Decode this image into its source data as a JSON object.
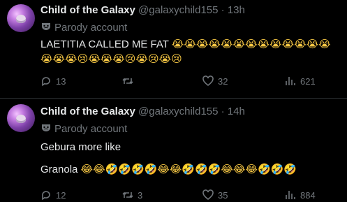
{
  "tweets": [
    {
      "name": "Child of the Galaxy",
      "handle": "@galaxychild155",
      "separator": "·",
      "time": "13h",
      "parody_label": "Parody account",
      "text_line1": "LAETITIA CALLED ME FAT ",
      "emoji_line1": "😭😭😭😭😭😭😭😭😭😭😭😭😭",
      "emoji_line2": "😭😭😭😢😭😭😭😢😭😢😭😢",
      "reply_count": "13",
      "retweet_count": "",
      "like_count": "32",
      "view_count": "621"
    },
    {
      "name": "Child of the Galaxy",
      "handle": "@galaxychild155",
      "separator": "·",
      "time": "14h",
      "parody_label": "Parody account",
      "text_line1": "Gebura more like",
      "text_line2": "Granola ",
      "emoji_line2": "😂😂🤣🤣🤣🤣😂😂🤣🤣🤣😂😂😂🤣🤣🤣",
      "reply_count": "12",
      "retweet_count": "3",
      "like_count": "35",
      "view_count": "884"
    }
  ],
  "icons": {
    "reply": "reply-icon",
    "retweet": "retweet-icon",
    "like": "heart-icon",
    "views": "views-chart-icon",
    "parody": "mask-icon"
  },
  "colors": {
    "background": "#000000",
    "text": "#e7e9ea",
    "secondary": "#71767b",
    "divider": "#2f3336"
  }
}
